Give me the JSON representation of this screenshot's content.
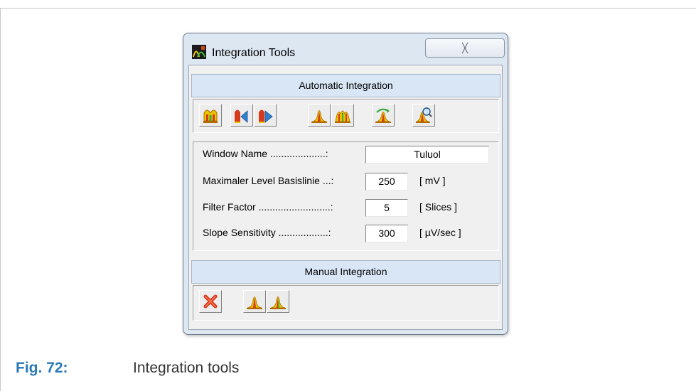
{
  "window": {
    "title": "Integration Tools",
    "close_symbol": "╳",
    "app_icon": "integration-tools-app-icon"
  },
  "automatic": {
    "header": "Automatic Integration",
    "tools": [
      {
        "icon": "auto-integrate-icon"
      },
      {
        "icon": "previous-peak-icon"
      },
      {
        "icon": "next-peak-icon"
      },
      {
        "icon": "single-peak-icon"
      },
      {
        "icon": "multi-peak-icon"
      },
      {
        "icon": "baseline-peak-icon"
      },
      {
        "icon": "zoom-peak-icon"
      }
    ]
  },
  "params": {
    "window_name": {
      "label": "Window Name ....................:",
      "value": "Tuluol"
    },
    "max_level": {
      "label": "Maximaler Level Basislinie ...:",
      "value": "250",
      "unit": "[ mV ]"
    },
    "filter_factor": {
      "label": "Filter Factor ..........................:",
      "value": "5",
      "unit": "[ Slices ]"
    },
    "slope": {
      "label": "Slope Sensitivity ..................:",
      "value": "300",
      "unit": "[ µV/sec ]"
    }
  },
  "manual": {
    "header": "Manual Integration",
    "tools": [
      {
        "icon": "delete-peak-icon"
      },
      {
        "icon": "manual-peak-icon"
      },
      {
        "icon": "split-peak-icon"
      }
    ]
  },
  "caption": {
    "label": "Fig. 72:",
    "text": "Integration tools"
  },
  "colors": {
    "caption_blue": "#2a7ab8",
    "section_header": "#d8e6f6"
  }
}
